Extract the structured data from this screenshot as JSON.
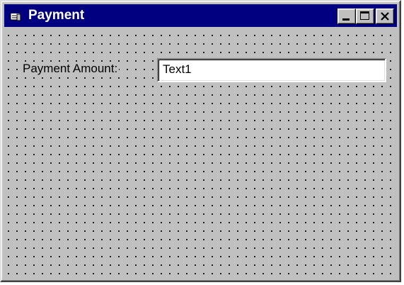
{
  "window": {
    "title": "Payment",
    "titlebar_color": "#000080",
    "background_color": "#c0c0c0",
    "icons": {
      "app": "form-icon",
      "minimize": "minimize-icon",
      "maximize": "maximize-icon",
      "close": "close-icon"
    }
  },
  "form": {
    "payment_amount_label": "Payment Amount:",
    "payment_amount_value": "Text1"
  }
}
